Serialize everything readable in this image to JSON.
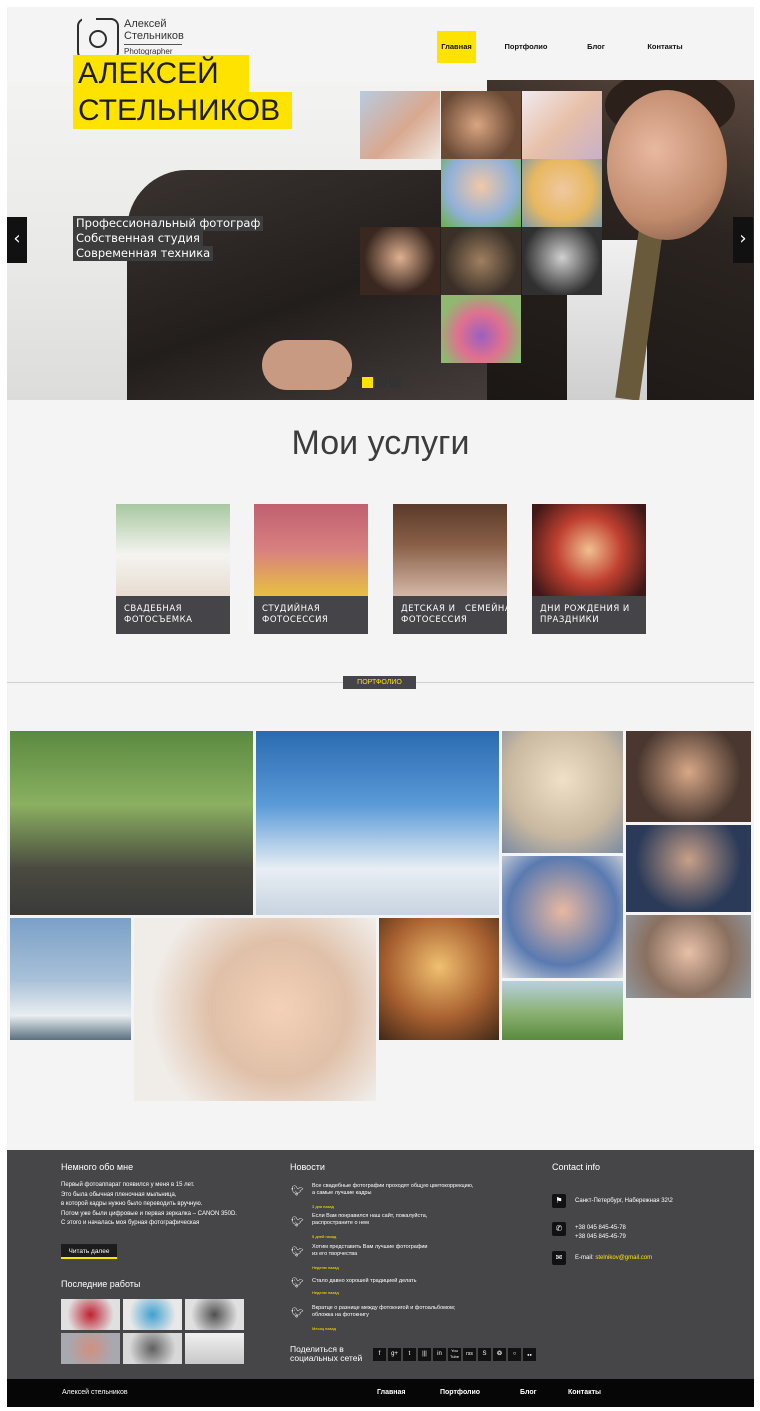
{
  "header": {
    "logo_name_line1": "Алексей",
    "logo_name_line2": "Стельников",
    "logo_sub": "Photographer",
    "nav": [
      "Главная",
      "Портфолио",
      "Блог",
      "Контакты"
    ],
    "active_nav": "Главная"
  },
  "hero": {
    "title_line1": "АЛЕКСЕЙ",
    "title_line2": "СТЕЛЬНИКОВ",
    "lines": [
      "Профессиональный фотограф",
      "Собственная студия",
      "Современная техника"
    ],
    "prev_icon": "chevron-left-icon",
    "next_icon": "chevron-right-icon",
    "slides": 4,
    "active_slide": 2
  },
  "services": {
    "title": "Мои услуги",
    "items": [
      {
        "line1": "СВАДЕБНАЯ",
        "line2": "ФОТОСЪЕМКА"
      },
      {
        "line1": "СТУДИЙНАЯ",
        "line2": "ФОТОСЕССИЯ"
      },
      {
        "line1": "ДЕТСКАЯ И   СЕМЕЙНАЯ",
        "line2": "ФОТОСЕССИЯ"
      },
      {
        "line1": "ДНИ РОЖДЕНИЯ И",
        "line2": "ПРАЗДНИКИ"
      }
    ]
  },
  "portfolio": {
    "label": "ПОРТФОЛИО"
  },
  "footer": {
    "about_title": "Немного обо мне",
    "about_lines": [
      "Первый фотоаппарат появился у меня в 15 лет.",
      "Это была обычная пленочная мыльница,",
      "в которой кадры нужно было переводить вручную.",
      "Потом уже были цифровые и первая зеркалка – CANON 350D.",
      "С этого и началась моя бурная фотографическая"
    ],
    "read_more": "Читать далее",
    "recent_title": "Последние работы",
    "news_title": "Новости",
    "news": [
      {
        "lines": [
          "Все свадебные фотографии проходят общую цветокоррекцию,",
          "а самые лучшие кадры"
        ],
        "when": "3 дня назад"
      },
      {
        "lines": [
          "Если Вам понравился наш сайт, пожалуйста,",
          "распространите о нем"
        ],
        "when": "5 дней назад"
      },
      {
        "lines": [
          "Хотим представить Вам лучшие фотографии",
          "из его творчества"
        ],
        "when": "Неделю назад"
      },
      {
        "lines": [
          "Стало давно хорошей традицией делать"
        ],
        "when": "Неделю назад"
      },
      {
        "lines": [
          "Вкратце о разнице между фотокнигой и фотоальбомом;",
          "обложка на фотокнигу"
        ],
        "when": "Месяц назад"
      }
    ],
    "share_line1": "Поделиться в",
    "share_line2": "социальных сетей",
    "social": [
      "f",
      "g+",
      "t",
      "|||",
      "in",
      "You Tube",
      "rss",
      "S",
      "❂",
      "○",
      "●●"
    ],
    "contact_title": "Contact info",
    "address": "Санкт-Петербург, Набережная 32\\2",
    "phone1": "+38 045 845-45-78",
    "phone2": "+38 045 845-45-79",
    "email_label": "E-mail: ",
    "email": "stelnikov@gmail.com",
    "accent": "#ffe300"
  },
  "bottom": {
    "copyright": "Алексей стельников",
    "nav": [
      "Главная",
      "Портфолио",
      "Блог",
      "Контакты"
    ]
  }
}
